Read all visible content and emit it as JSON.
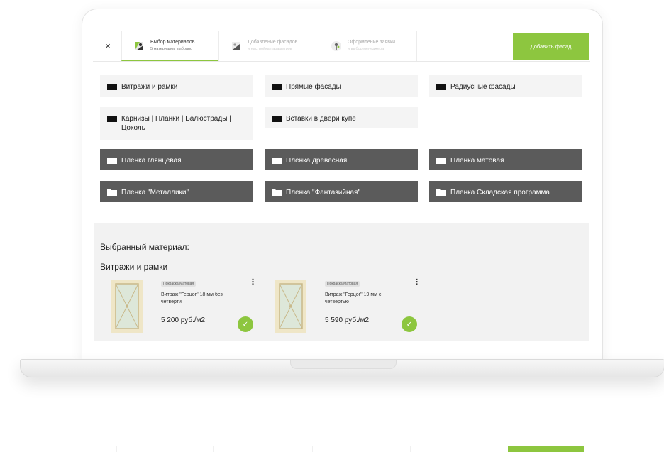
{
  "steps": [
    {
      "title": "Выбор материалов",
      "subtitle": "5 материалов выбрано"
    },
    {
      "title": "Добавление фасадов",
      "subtitle": "и настройка параметров"
    },
    {
      "title": "Оформление заявки",
      "subtitle": "и выбор менеджера"
    }
  ],
  "toolbar": {
    "close_glyph": "×",
    "add_button": "Добавить фасад"
  },
  "categories": [
    "Витражи и рамки",
    "Прямые фасады",
    "Радиусные фасады",
    "Карнизы | Планки | Балюстрады | Цоколь",
    "Вставки в двери купе"
  ],
  "films": [
    "Пленка глянцевая",
    "Пленка древесная",
    "Пленка матовая",
    "Пленка \"Металлики\"",
    "Пленка \"Фантазийная\"",
    "Пленка Складская программа"
  ],
  "selected": {
    "heading": "Выбранный материал:",
    "group": "Витражи и рамки",
    "items": [
      {
        "tag": "Покраска Матовая",
        "name": "Витраж \"Герцог\" 18 мм без четверти",
        "price": "5 200 руб./м2",
        "check": "✓",
        "menu": "⋮"
      },
      {
        "tag": "Покраска Матовая",
        "name": "Витраж \"Герцог\" 19 мм с четвертью",
        "price": "5 590 руб./м2",
        "check": "✓",
        "menu": "⋮"
      }
    ]
  },
  "colors": {
    "accent": "#8dc63f",
    "dark_tile": "#5b5b5b",
    "light_tile": "#f4f4f4"
  }
}
